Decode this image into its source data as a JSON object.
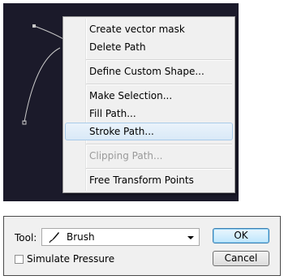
{
  "context_menu": {
    "items": [
      {
        "label": "Create vector mask",
        "enabled": true
      },
      {
        "label": "Delete Path",
        "enabled": true
      },
      {
        "label": "Define Custom Shape...",
        "enabled": true
      },
      {
        "label": "Make Selection...",
        "enabled": true
      },
      {
        "label": "Fill Path...",
        "enabled": true
      },
      {
        "label": "Stroke Path...",
        "enabled": true,
        "highlighted": true
      },
      {
        "label": "Clipping Path...",
        "enabled": false
      },
      {
        "label": "Free Transform Points",
        "enabled": true
      }
    ]
  },
  "stroke_dialog": {
    "tool_label": "Tool:",
    "tool_value": "Brush",
    "tool_icon": "brush-icon",
    "simulate_pressure_label": "Simulate Pressure",
    "simulate_pressure_checked": false,
    "ok_label": "OK",
    "cancel_label": "Cancel"
  },
  "colors": {
    "canvas_background": "#1b1a2a",
    "path_stroke": "#c8c8c8",
    "menu_highlight_border": "#a8cbe9"
  }
}
